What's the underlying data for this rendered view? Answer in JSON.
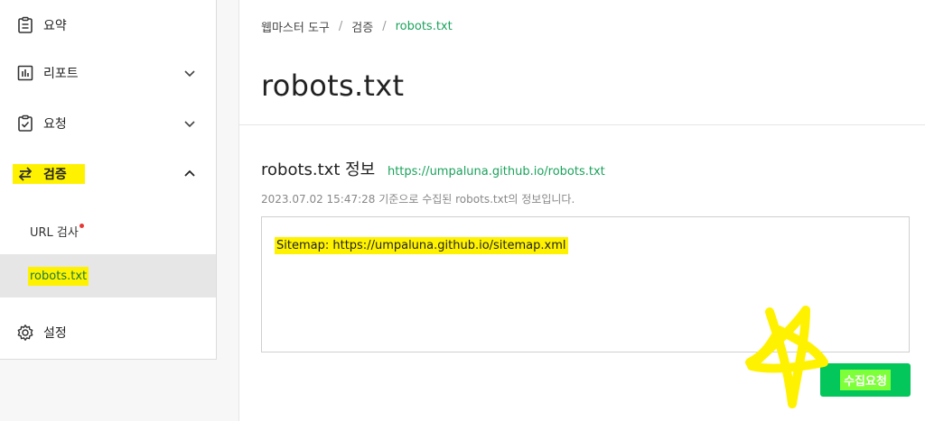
{
  "sidebar": {
    "items": [
      {
        "label": "요약",
        "icon": "clipboard-icon"
      },
      {
        "label": "리포트",
        "icon": "bar-chart-icon"
      },
      {
        "label": "요청",
        "icon": "checkbox-clipboard-icon"
      },
      {
        "label": "검증",
        "icon": "swap-arrows-icon"
      },
      {
        "label": "설정",
        "icon": "gear-icon"
      }
    ],
    "sub_items": [
      {
        "label": "URL 검사"
      },
      {
        "label": "robots.txt"
      }
    ]
  },
  "breadcrumb": [
    "웹마스터 도구",
    "검증",
    "robots.txt"
  ],
  "breadcrumb_sep": "/",
  "page_title": "robots.txt",
  "section": {
    "title": "robots.txt 정보",
    "url": "https://umpaluna.github.io/robots.txt",
    "meta": "2023.07.02 15:47:28 기준으로 수집된 robots.txt의 정보입니다.",
    "content": "Sitemap: https://umpaluna.github.io/sitemap.xml"
  },
  "submit_label": "수집요청",
  "colors": {
    "accent": "#03c75a",
    "link": "#1aa25b",
    "highlight": "#fff200",
    "badge": "#e53935"
  }
}
